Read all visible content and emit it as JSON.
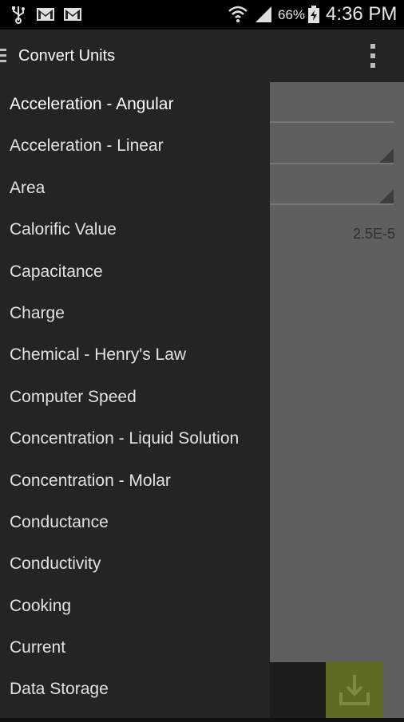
{
  "status_bar": {
    "icons": [
      "usb-icon",
      "gmail-icon",
      "gmail-icon",
      "wifi-icon",
      "signal-icon",
      "battery-charging-icon"
    ],
    "battery": "66%",
    "time": "4:36 PM"
  },
  "action_bar": {
    "title": "Convert Units",
    "drawer_icon": "drawer-toggle-icon",
    "menu_icon": "overflow-menu-icon"
  },
  "content": {
    "result_value": "2.5E-5",
    "download_icon": "download-icon",
    "accent_color": "#5f6a22"
  },
  "drawer": {
    "items": [
      {
        "label": "Acceleration - Angular"
      },
      {
        "label": "Acceleration - Linear"
      },
      {
        "label": "Area"
      },
      {
        "label": "Calorific Value"
      },
      {
        "label": "Capacitance"
      },
      {
        "label": "Charge"
      },
      {
        "label": "Chemical - Henry's Law"
      },
      {
        "label": "Computer Speed"
      },
      {
        "label": "Concentration - Liquid Solution"
      },
      {
        "label": "Concentration - Molar"
      },
      {
        "label": "Conductance"
      },
      {
        "label": "Conductivity"
      },
      {
        "label": "Cooking"
      },
      {
        "label": "Current"
      },
      {
        "label": "Data Storage"
      }
    ]
  }
}
